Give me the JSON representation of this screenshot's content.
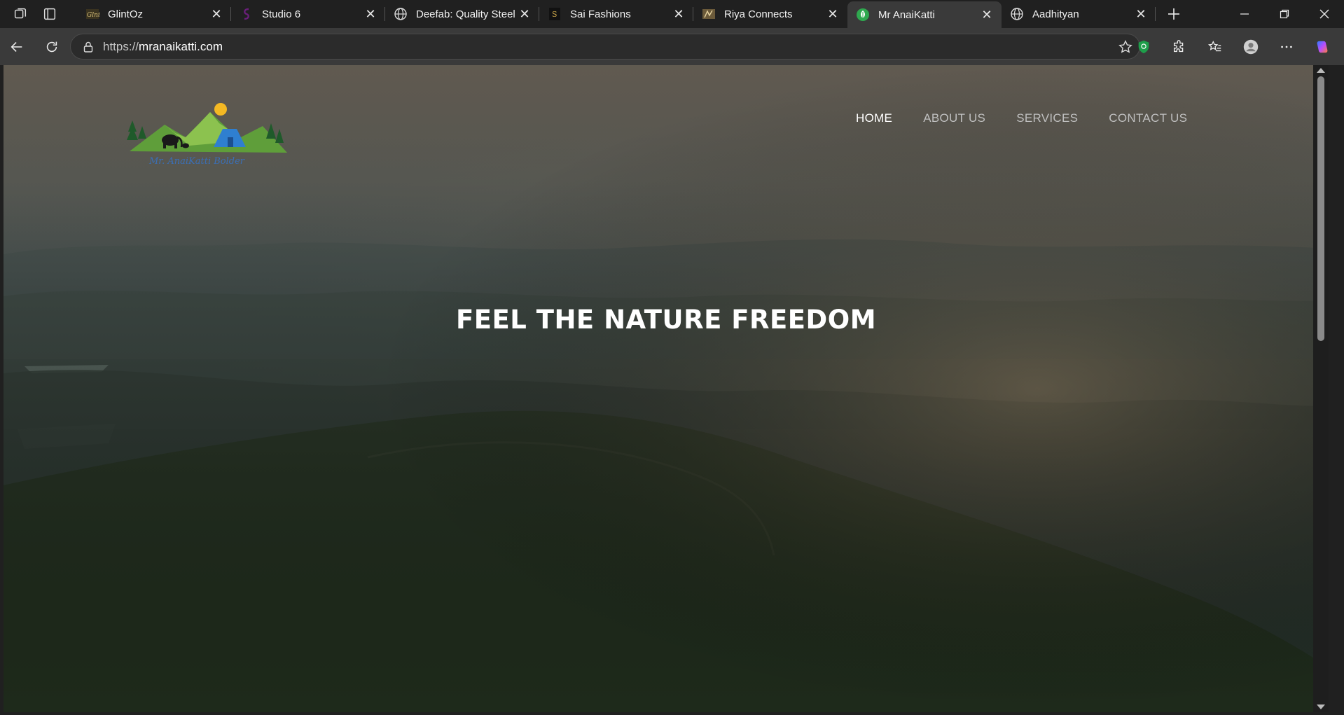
{
  "browser": {
    "tabs": [
      {
        "title": "GlintOz",
        "favicon": "glintoz-favicon",
        "active": false
      },
      {
        "title": "Studio 6",
        "favicon": "studio6-favicon",
        "active": false
      },
      {
        "title": "Deefab: Quality Steel",
        "favicon": "globe-icon",
        "active": false
      },
      {
        "title": "Sai Fashions",
        "favicon": "sai-fashions-favicon",
        "active": false
      },
      {
        "title": "Riya Connects",
        "favicon": "riya-favicon",
        "active": false
      },
      {
        "title": "Mr AnaiKatti",
        "favicon": "leaf-favicon",
        "active": true
      },
      {
        "title": "Aadhityan",
        "favicon": "globe-icon",
        "active": false
      }
    ],
    "address": {
      "protocol": "https://",
      "domain": "mranaikatti.com"
    }
  },
  "site": {
    "logo_text": "Mr. AnaiKatti Bolder",
    "nav": [
      {
        "label": "HOME",
        "active": true
      },
      {
        "label": "ABOUT US",
        "active": false
      },
      {
        "label": "SERVICES",
        "active": false
      },
      {
        "label": "CONTACT US",
        "active": false
      }
    ],
    "hero_title": "FEEL THE NATURE FREEDOM"
  },
  "colors": {
    "chrome_bg": "#202020",
    "toolbar_bg": "#3a3a3a",
    "nav_active": "#ffffff",
    "nav_inactive": "#bfbfbf",
    "shield_green": "#1e9e4a"
  }
}
